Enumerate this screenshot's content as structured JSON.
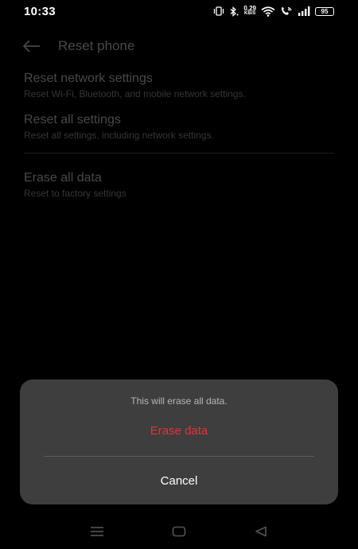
{
  "status_bar": {
    "time": "10:33",
    "net_speed_value": "0.29",
    "net_speed_unit": "KB/S",
    "battery": "95"
  },
  "header": {
    "title": "Reset phone",
    "back_icon": "back-arrow-icon"
  },
  "settings": [
    {
      "title": "Reset network settings",
      "description": "Reset Wi-Fi, Bluetooth, and mobile network settings."
    },
    {
      "title": "Reset all settings",
      "description": "Reset all settings, including network settings."
    },
    {
      "title": "Erase all data",
      "description": "Reset to factory settings"
    }
  ],
  "dialog": {
    "message": "This will erase all data.",
    "confirm_label": "Erase data",
    "cancel_label": "Cancel"
  },
  "colors": {
    "background": "#000000",
    "dialog_bg": "#3e3e3e",
    "destructive": "#e8303a"
  },
  "nav_bar": {
    "icons": [
      "menu-icon",
      "home-icon",
      "back-icon"
    ]
  }
}
